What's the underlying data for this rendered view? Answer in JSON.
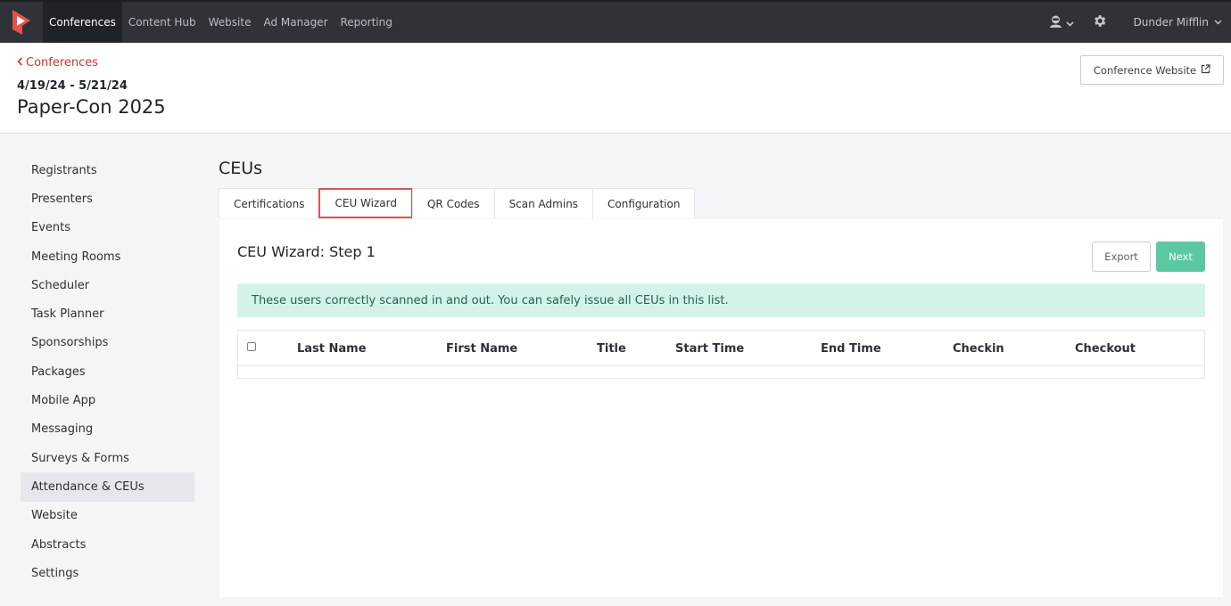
{
  "topnav": {
    "items": [
      {
        "label": "Conferences",
        "active": true
      },
      {
        "label": "Content Hub",
        "active": false
      },
      {
        "label": "Website",
        "active": false
      },
      {
        "label": "Ad Manager",
        "active": false
      },
      {
        "label": "Reporting",
        "active": false
      }
    ],
    "user_name": "Dunder Mifflin",
    "icons": [
      "support-agent-icon",
      "chevron-down-icon",
      "gear-icon"
    ]
  },
  "header": {
    "back_label": "Conferences",
    "date_range": "4/19/24 - 5/21/24",
    "title": "Paper-Con 2025",
    "website_button": "Conference Website"
  },
  "sidebar": {
    "items": [
      {
        "label": "Registrants",
        "active": false
      },
      {
        "label": "Presenters",
        "active": false
      },
      {
        "label": "Events",
        "active": false
      },
      {
        "label": "Meeting Rooms",
        "active": false
      },
      {
        "label": "Scheduler",
        "active": false
      },
      {
        "label": "Task Planner",
        "active": false
      },
      {
        "label": "Sponsorships",
        "active": false
      },
      {
        "label": "Packages",
        "active": false
      },
      {
        "label": "Mobile App",
        "active": false
      },
      {
        "label": "Messaging",
        "active": false
      },
      {
        "label": "Surveys & Forms",
        "active": false
      },
      {
        "label": "Attendance & CEUs",
        "active": true
      },
      {
        "label": "Website",
        "active": false
      },
      {
        "label": "Abstracts",
        "active": false
      },
      {
        "label": "Settings",
        "active": false
      }
    ]
  },
  "section": {
    "title": "CEUs",
    "tabs": [
      {
        "label": "Certifications",
        "highlighted": false
      },
      {
        "label": "CEU Wizard",
        "highlighted": true
      },
      {
        "label": "QR Codes",
        "highlighted": false
      },
      {
        "label": "Scan Admins",
        "highlighted": false
      },
      {
        "label": "Configuration",
        "highlighted": false
      }
    ]
  },
  "wizard": {
    "title": "CEU Wizard: Step 1",
    "export_label": "Export",
    "next_label": "Next",
    "alert": "These users correctly scanned in and out. You can safely issue all CEUs in this list.",
    "columns": [
      "Last Name",
      "First Name",
      "Title",
      "Start Time",
      "End Time",
      "Checkin",
      "Checkout"
    ]
  },
  "colors": {
    "accent_red": "#c0392b",
    "next_green": "#5cc8a2",
    "alert_bg": "#d3f3ea",
    "nav_bg": "#2f3338"
  }
}
